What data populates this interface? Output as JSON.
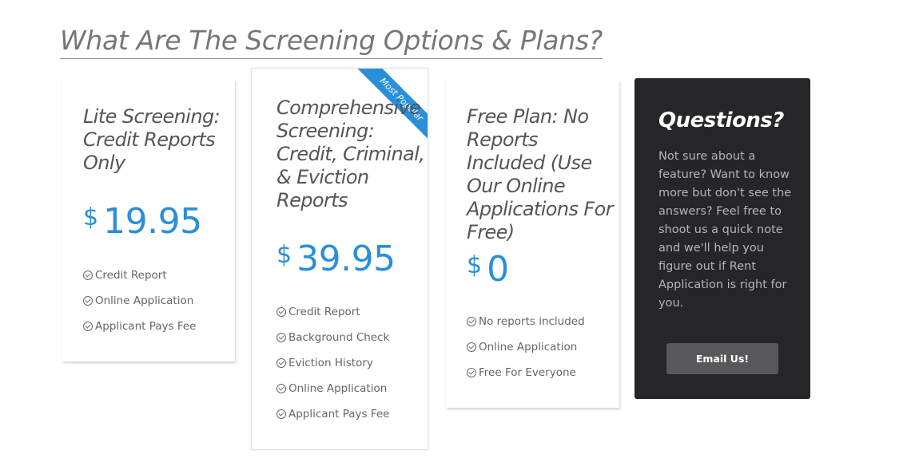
{
  "heading": "What Are The Screening Options & Plans?",
  "plans": [
    {
      "title": "Lite Screening: Credit Reports Only",
      "currency": "$",
      "price": "19.95",
      "features": [
        "Credit Report",
        "Online Application",
        "Applicant Pays Fee"
      ]
    },
    {
      "title": "Comprehensive Screening: Credit, Criminal, & Eviction Reports",
      "badge": "Most Popular",
      "currency": "$",
      "price": "39.95",
      "features": [
        "Credit Report",
        "Background Check",
        "Eviction History",
        "Online Application",
        "Applicant Pays Fee"
      ]
    },
    {
      "title": "Free Plan: No Reports Included (Use Our Online Applications For Free)",
      "currency": "$",
      "price": "0",
      "features": [
        "No reports included",
        "Online Application",
        "Free For Everyone"
      ]
    }
  ],
  "questions": {
    "title": "Questions?",
    "body": "Not sure about a feature? Want to know more but don't see the answers? Feel free to shoot us a quick note and we'll help you figure out if Rent Application is right for you.",
    "button_label": "Email Us!"
  },
  "colors": {
    "accent": "#2a8fd8",
    "dark_panel": "#262628",
    "button": "#58585a"
  },
  "icons": {
    "feature": "check-circle-icon"
  }
}
